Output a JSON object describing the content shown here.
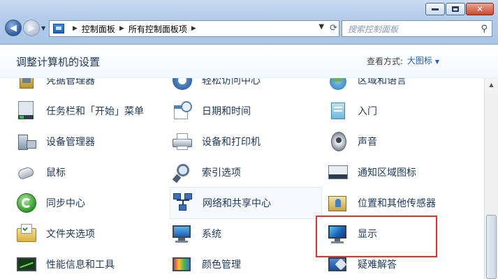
{
  "window": {
    "minimize_label": "–",
    "maximize_label": "□",
    "close_label": "✕"
  },
  "nav": {
    "back_glyph": "◀",
    "forward_glyph": "▶",
    "dropdown_glyph": "▼"
  },
  "breadcrumb": {
    "items": [
      "控制面板",
      "所有控制面板项"
    ],
    "separator": "▶"
  },
  "search": {
    "placeholder": "搜索控制面板"
  },
  "header": {
    "title": "调整计算机的设置",
    "view_by_label": "查看方式:",
    "view_by_value": "大图标"
  },
  "items": [
    {
      "label": "凭据管理器",
      "icon": "credential-manager-icon"
    },
    {
      "label": "轻松访问中心",
      "icon": "ease-of-access-icon"
    },
    {
      "label": "区域和语言",
      "icon": "region-language-icon"
    },
    {
      "label": "任务栏和「开始」菜单",
      "icon": "taskbar-start-menu-icon"
    },
    {
      "label": "日期和时间",
      "icon": "date-time-icon"
    },
    {
      "label": "入门",
      "icon": "getting-started-icon"
    },
    {
      "label": "设备管理器",
      "icon": "device-manager-icon"
    },
    {
      "label": "设备和打印机",
      "icon": "devices-printers-icon"
    },
    {
      "label": "声音",
      "icon": "sound-icon"
    },
    {
      "label": "鼠标",
      "icon": "mouse-icon"
    },
    {
      "label": "索引选项",
      "icon": "indexing-options-icon"
    },
    {
      "label": "通知区域图标",
      "icon": "notification-area-icon"
    },
    {
      "label": "同步中心",
      "icon": "sync-center-icon"
    },
    {
      "label": "网络和共享中心",
      "icon": "network-sharing-icon"
    },
    {
      "label": "位置和其他传感器",
      "icon": "location-sensors-icon"
    },
    {
      "label": "文件夹选项",
      "icon": "folder-options-icon"
    },
    {
      "label": "系统",
      "icon": "system-icon"
    },
    {
      "label": "显示",
      "icon": "display-icon"
    },
    {
      "label": "性能信息和工具",
      "icon": "performance-icon"
    },
    {
      "label": "颜色管理",
      "icon": "color-management-icon"
    },
    {
      "label": "疑难解答",
      "icon": "troubleshooting-icon"
    }
  ],
  "colors": {
    "highlight_box": "#e0312a",
    "link_blue": "#1a5fb4"
  }
}
